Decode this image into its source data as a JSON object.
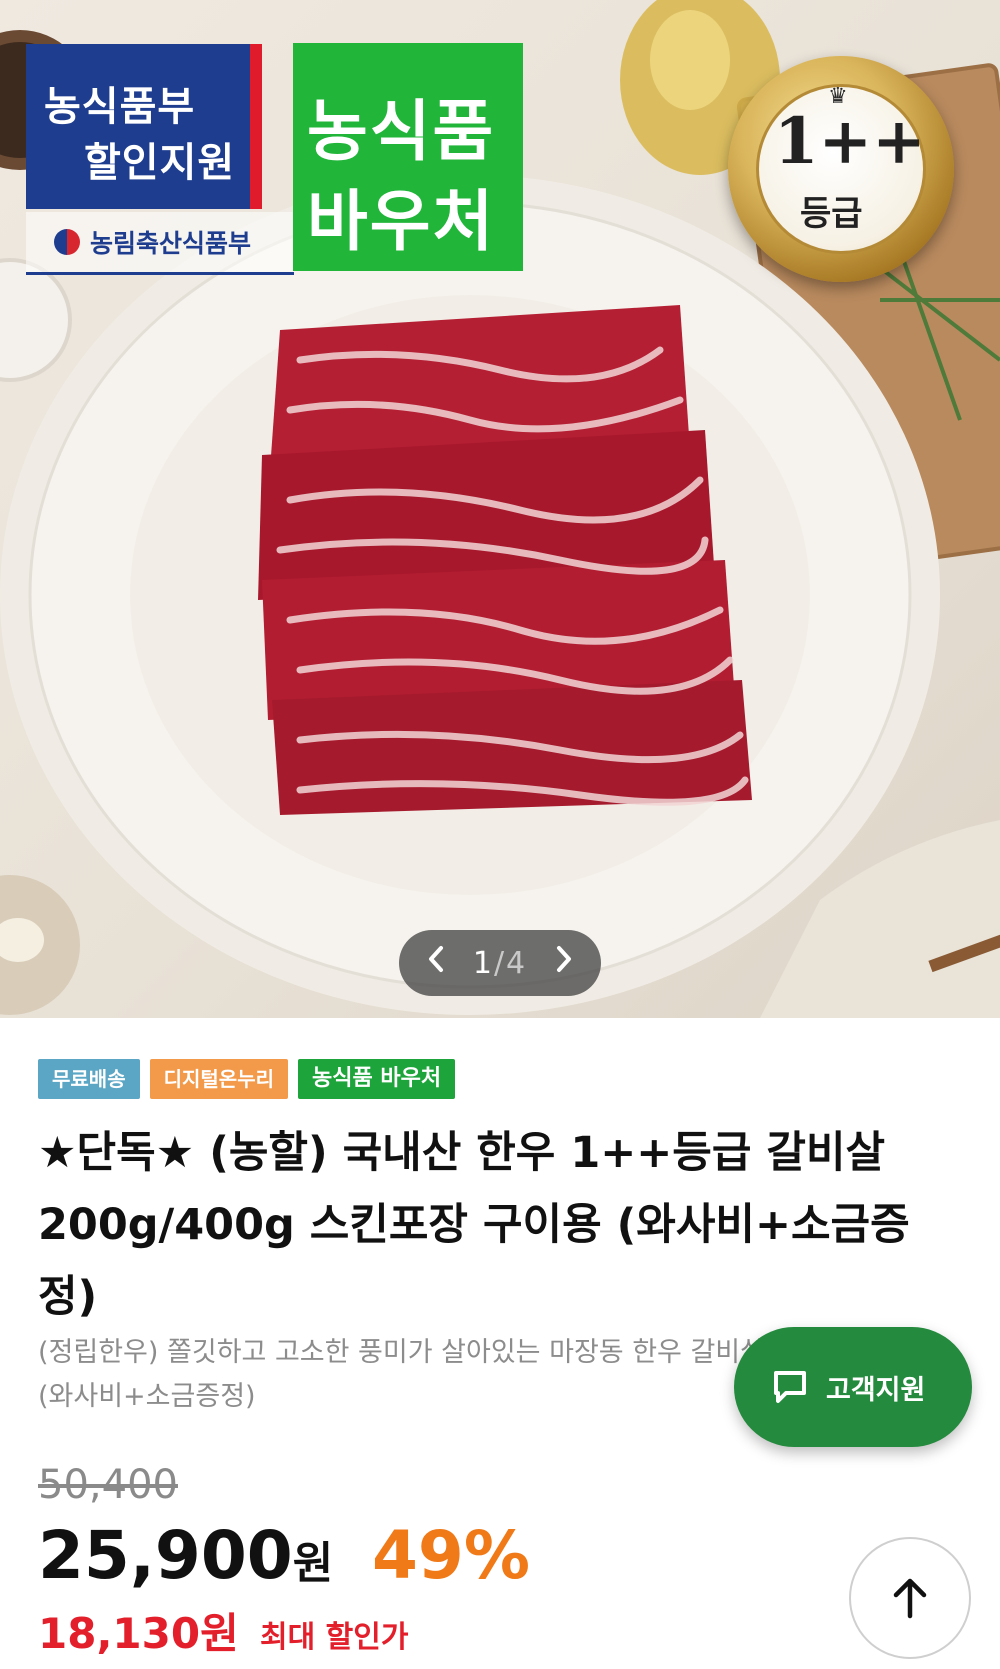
{
  "hero": {
    "badge_gov_line1": "농식품부",
    "badge_gov_line2": "할인지원",
    "badge_gov_sub": "농림축산식품부",
    "badge_voucher_line1": "농식품",
    "badge_voucher_line2": "바우처",
    "grade_value": "1++",
    "grade_label": "등급",
    "pager": {
      "current": "1",
      "separator": "/",
      "total": "4"
    }
  },
  "tags": [
    "무료배송",
    "디지털온누리",
    "농식품 바우처"
  ],
  "product": {
    "title": "★단독★ (농할) 국내산 한우 1++등급 갈비살 200g/400g 스킨포장 구이용 (와사비+소금증정)",
    "subtitle": "(정립한우) 쫄깃하고 고소한 풍미가 살아있는 마장동 한우 갈비살 (와사비+소금증정)"
  },
  "price": {
    "original": "50,400",
    "current": "25,900",
    "currency": "원",
    "discount": "49%",
    "max_discount": "18,130원",
    "max_discount_label": "최대 할인가"
  },
  "floating": {
    "support_label": "고객지원"
  },
  "colors": {
    "voucher_green": "#1da43b",
    "support_green": "#248a3d",
    "discount_orange": "#f07a18",
    "max_price_red": "#e21f2a",
    "gov_blue": "#1e3d8f"
  },
  "icons": [
    "chevron-left-icon",
    "chevron-right-icon",
    "chat-icon",
    "arrow-up-icon",
    "crown-icon"
  ]
}
